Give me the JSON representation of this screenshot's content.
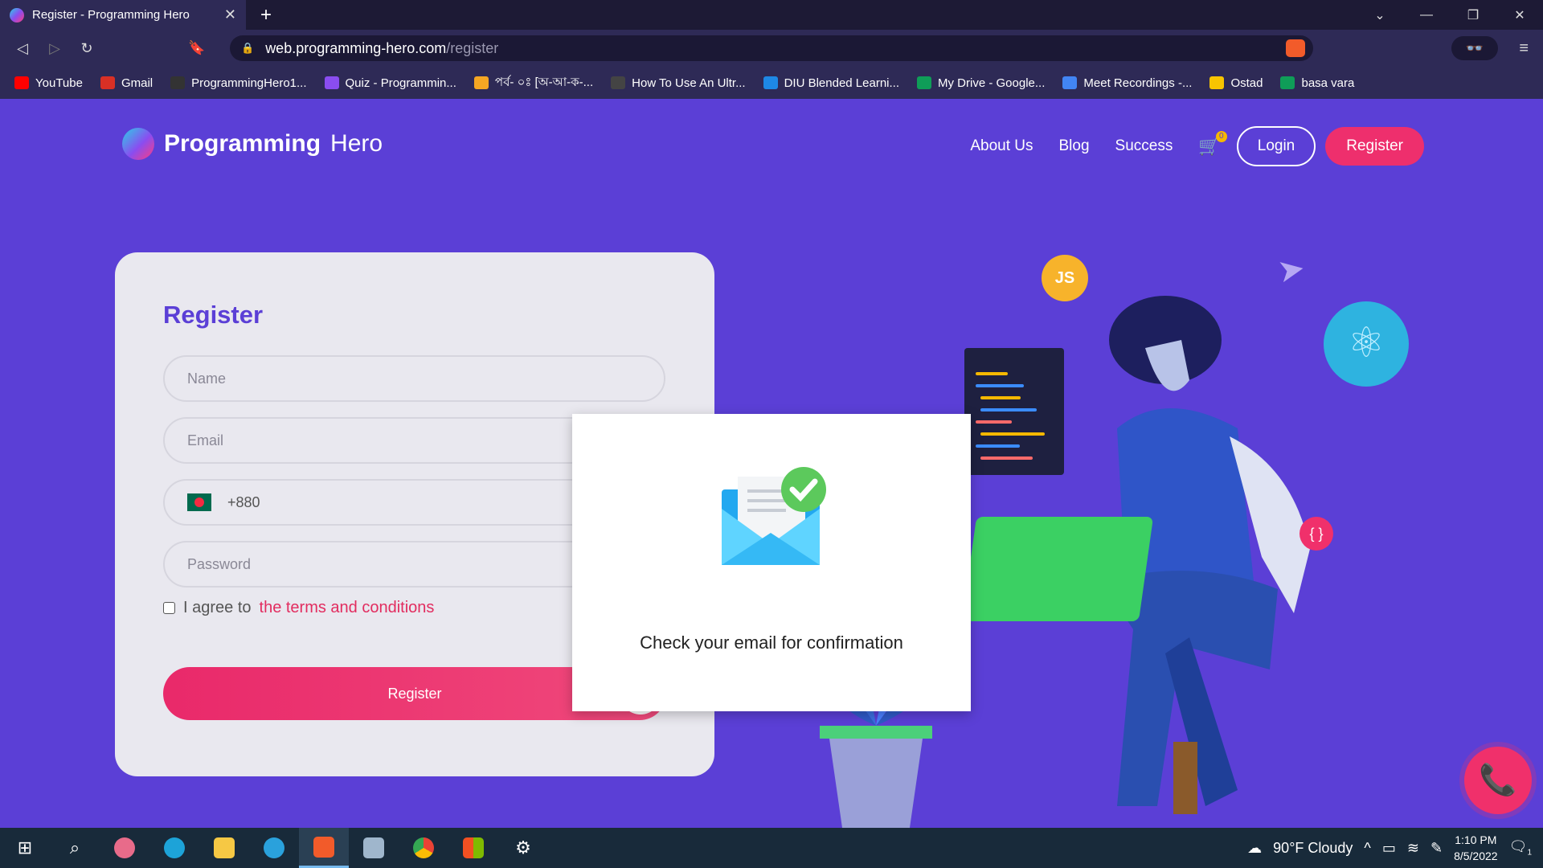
{
  "browser": {
    "tab_title": "Register - Programming Hero",
    "tab_close": "✕",
    "new_tab": "+",
    "url_host": "web.programming-hero.com",
    "url_path": "/register",
    "window_controls": {
      "minimize": "—",
      "restore": "❐",
      "close": "✕",
      "tabs_menu": "⌄"
    },
    "nav": {
      "back": "◁",
      "forward": "▷",
      "reload": "↻",
      "bookmark": "🔖"
    },
    "menu": "≡",
    "extension": "👓",
    "bookmarks": [
      {
        "label": "YouTube",
        "color": "#ff0000"
      },
      {
        "label": "Gmail",
        "color": "#d93025"
      },
      {
        "label": "ProgrammingHero1...",
        "color": "#333333"
      },
      {
        "label": "Quiz - Programmin...",
        "color": "#8a4df0"
      },
      {
        "label": "পর্ব- ০ঃ [অ-আ-ক-...",
        "color": "#f5a623"
      },
      {
        "label": "How To Use An Ultr...",
        "color": "#444444"
      },
      {
        "label": "DIU Blended Learni...",
        "color": "#1e88e5"
      },
      {
        "label": "My Drive - Google...",
        "color": "#0f9d58"
      },
      {
        "label": "Meet Recordings -...",
        "color": "#4285f4"
      },
      {
        "label": "Ostad",
        "color": "#f7c400"
      },
      {
        "label": "basa vara",
        "color": "#0f9d58"
      }
    ]
  },
  "site": {
    "logo_main": "Programming",
    "logo_sub": "Hero",
    "nav": [
      {
        "label": "About Us"
      },
      {
        "label": "Blog"
      },
      {
        "label": "Success"
      }
    ],
    "cart_icon": "🛒",
    "cart_count": "0",
    "login_label": "Login",
    "register_label": "Register"
  },
  "form": {
    "title": "Register",
    "name_placeholder": "Name",
    "email_placeholder": "Email",
    "phone_code": "+880",
    "password_placeholder": "Password",
    "agree_text": "I agree to",
    "terms_link": "the terms and conditions",
    "submit_label": "Register",
    "submit_icon": "→"
  },
  "illustration": {
    "js_badge": "JS",
    "react_icon": "⚛",
    "braces_badge": "{ }",
    "plane_icon": "➤"
  },
  "modal": {
    "message": "Check your email for confirmation"
  },
  "call_icon": "📞",
  "taskbar": {
    "weather": "90°F  Cloudy",
    "time": "1:10 PM",
    "date": "8/5/2022",
    "notifications": "1"
  }
}
